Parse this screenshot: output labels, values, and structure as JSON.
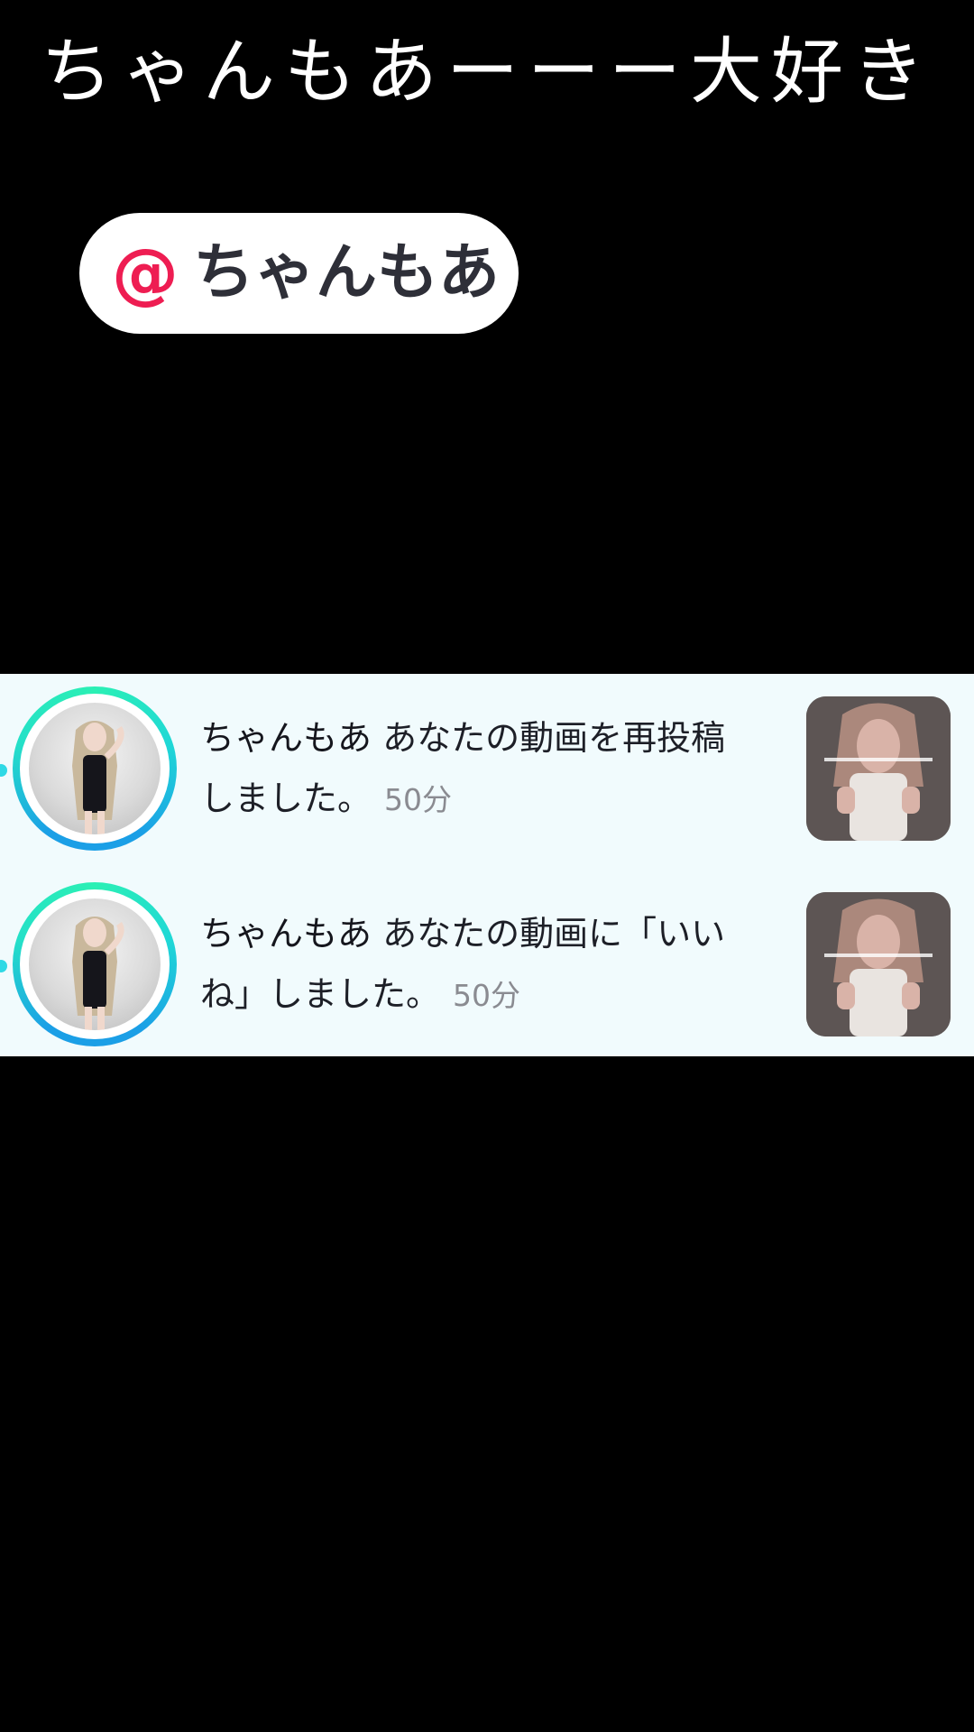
{
  "caption": "ちゃんもあーーー大好き",
  "mention": {
    "at_symbol": "@",
    "username": "ちゃんもあ"
  },
  "notifications": [
    {
      "username": "ちゃんもあ",
      "action": " あなたの動画を再投稿しました。",
      "time": "50分",
      "avatar_icon": "profile-photo",
      "thumbnail_icon": "video-thumbnail"
    },
    {
      "username": "ちゃんもあ",
      "action": " あなたの動画に「いいね」しました。",
      "time": "50分",
      "avatar_icon": "profile-photo",
      "thumbnail_icon": "video-thumbnail"
    }
  ],
  "colors": {
    "at_symbol": "#ee1d52",
    "panel_background": "#f1fbfd",
    "ring_start": "#1b9fe6",
    "ring_end": "#2bf0b4",
    "time_text": "#8a8b91"
  }
}
